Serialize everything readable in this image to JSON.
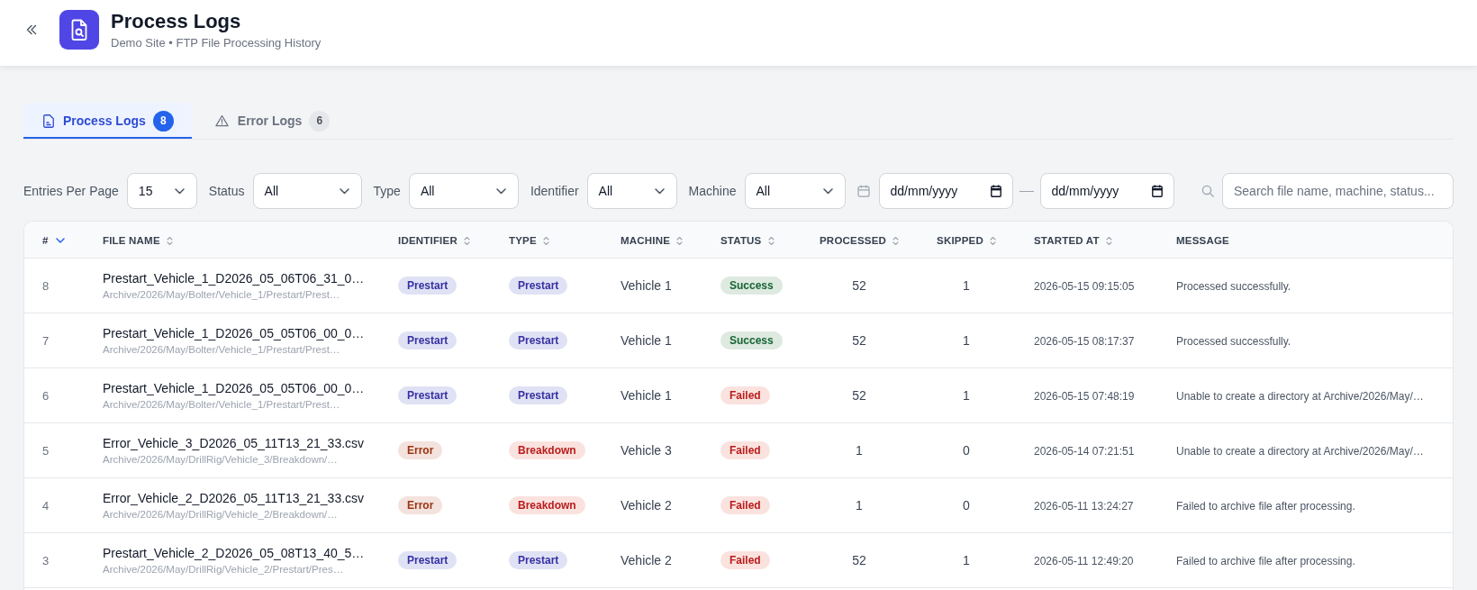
{
  "header": {
    "title": "Process Logs",
    "subtitle": "Demo Site • FTP File Processing History"
  },
  "tabs": [
    {
      "label": "Process Logs",
      "count": "8",
      "selected": true
    },
    {
      "label": "Error Logs",
      "count": "6",
      "selected": false
    }
  ],
  "filters": [
    {
      "label": "Entries Per Page",
      "value": "15"
    },
    {
      "label": "Status",
      "value": "All"
    },
    {
      "label": "Type",
      "value": "All"
    },
    {
      "label": "Identifier",
      "value": "All"
    },
    {
      "label": "Machine",
      "value": "All"
    }
  ],
  "date_range": {
    "from": {
      "placeholder": "dd/mm/yyyy"
    },
    "to": {
      "placeholder": "dd/mm/yyyy"
    }
  },
  "search": {
    "placeholder": "Search file name, machine, status..."
  },
  "table": {
    "columns": [
      {
        "label": "#",
        "sortable": true,
        "sorted": true
      },
      {
        "label": "FILE NAME",
        "sortable": true,
        "sorted": false
      },
      {
        "label": "IDENTIFIER",
        "sortable": true,
        "sorted": false
      },
      {
        "label": "TYPE",
        "sortable": true,
        "sorted": false
      },
      {
        "label": "MACHINE",
        "sortable": true,
        "sorted": false
      },
      {
        "label": "STATUS",
        "sortable": true,
        "sorted": false
      },
      {
        "label": "PROCESSED",
        "sortable": true,
        "sorted": false
      },
      {
        "label": "SKIPPED",
        "sortable": true,
        "sorted": false
      },
      {
        "label": "STARTED AT",
        "sortable": true,
        "sorted": false
      },
      {
        "label": "MESSAGE",
        "sortable": false,
        "sorted": false
      }
    ],
    "rows": [
      {
        "number": "8",
        "file_name": "Prestart_Vehicle_1_D2026_05_06T06_31_0…",
        "file_path": "Archive/2026/May/Bolter/Vehicle_1/Prestart/Prest…",
        "identifier": {
          "label": "Prestart",
          "color": "#3730a3"
        },
        "type": {
          "label": "Prestart",
          "color": "#3730a3"
        },
        "machine": "Vehicle 1",
        "status": {
          "label": "Success",
          "color": "#166534"
        },
        "processed": "52",
        "skipped": "1",
        "started_at": "2026-05-15 09:15:05",
        "message": "Processed successfully."
      },
      {
        "number": "7",
        "file_name": "Prestart_Vehicle_1_D2026_05_05T06_00_0…",
        "file_path": "Archive/2026/May/Bolter/Vehicle_1/Prestart/Prest…",
        "identifier": {
          "label": "Prestart",
          "color": "#3730a3"
        },
        "type": {
          "label": "Prestart",
          "color": "#3730a3"
        },
        "machine": "Vehicle 1",
        "status": {
          "label": "Success",
          "color": "#166534"
        },
        "processed": "52",
        "skipped": "1",
        "started_at": "2026-05-15 08:17:37",
        "message": "Processed successfully."
      },
      {
        "number": "6",
        "file_name": "Prestart_Vehicle_1_D2026_05_05T06_00_0…",
        "file_path": "Archive/2026/May/Bolter/Vehicle_1/Prestart/Prest…",
        "identifier": {
          "label": "Prestart",
          "color": "#3730a3"
        },
        "type": {
          "label": "Prestart",
          "color": "#3730a3"
        },
        "machine": "Vehicle 1",
        "status": {
          "label": "Failed",
          "color": "#b91c1c"
        },
        "processed": "52",
        "skipped": "1",
        "started_at": "2026-05-15 07:48:19",
        "message": "Unable to create a directory at Archive/2026/May/…"
      },
      {
        "number": "5",
        "file_name": "Error_Vehicle_3_D2026_05_11T13_21_33.csv",
        "file_path": "Archive/2026/May/DrillRig/Vehicle_3/Breakdown/…",
        "identifier": {
          "label": "Error",
          "color": "#9a3412"
        },
        "type": {
          "label": "Breakdown",
          "color": "#b91c1c"
        },
        "machine": "Vehicle 3",
        "status": {
          "label": "Failed",
          "color": "#b91c1c"
        },
        "processed": "1",
        "skipped": "0",
        "started_at": "2026-05-14 07:21:51",
        "message": "Unable to create a directory at Archive/2026/May/…"
      },
      {
        "number": "4",
        "file_name": "Error_Vehicle_2_D2026_05_11T13_21_33.csv",
        "file_path": "Archive/2026/May/DrillRig/Vehicle_2/Breakdown/…",
        "identifier": {
          "label": "Error",
          "color": "#9a3412"
        },
        "type": {
          "label": "Breakdown",
          "color": "#b91c1c"
        },
        "machine": "Vehicle 2",
        "status": {
          "label": "Failed",
          "color": "#b91c1c"
        },
        "processed": "1",
        "skipped": "0",
        "started_at": "2026-05-11 13:24:27",
        "message": "Failed to archive file after processing."
      },
      {
        "number": "3",
        "file_name": "Prestart_Vehicle_2_D2026_05_08T13_40_5…",
        "file_path": "Archive/2026/May/DrillRig/Vehicle_2/Prestart/Pres…",
        "identifier": {
          "label": "Prestart",
          "color": "#3730a3"
        },
        "type": {
          "label": "Prestart",
          "color": "#3730a3"
        },
        "machine": "Vehicle 2",
        "status": {
          "label": "Failed",
          "color": "#b91c1c"
        },
        "processed": "52",
        "skipped": "1",
        "started_at": "2026-05-11 12:49:20",
        "message": "Failed to archive file after processing."
      }
    ]
  }
}
